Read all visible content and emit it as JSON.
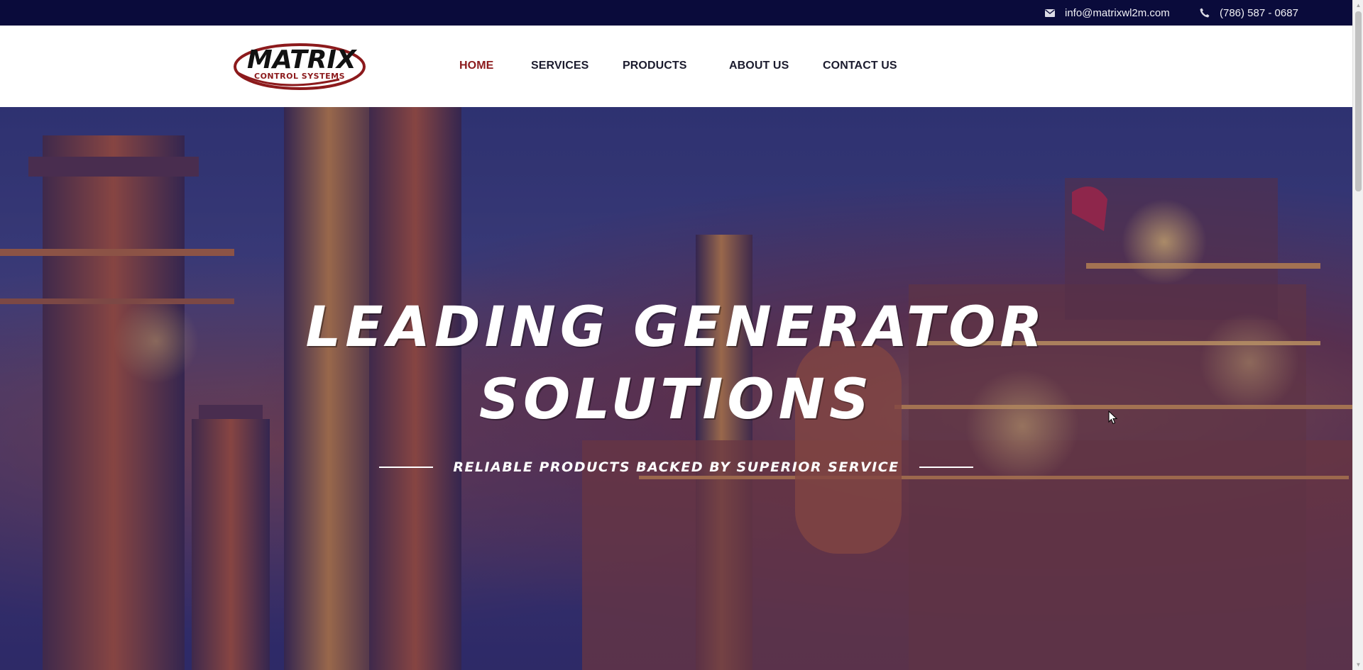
{
  "topbar": {
    "email": "info@matrixwl2m.com",
    "phone": "(786) 587 - 0687",
    "email_icon": "envelope-icon",
    "phone_icon": "phone-icon"
  },
  "brand": {
    "logo_word": "MATRIX",
    "logo_sub": "CONTROL SYSTEMS",
    "accent_color": "#8c1a1c",
    "dark_color": "#0a0b3b"
  },
  "nav": {
    "items": [
      {
        "label": "HOME",
        "active": true
      },
      {
        "label": "SERVICES",
        "active": false
      },
      {
        "label": "PRODUCTS",
        "active": false
      },
      {
        "label": "ABOUT US",
        "active": false
      },
      {
        "label": "CONTACT US",
        "active": false
      }
    ]
  },
  "hero": {
    "title_line1": "LEADING GENERATOR",
    "title_line2": "SOLUTIONS",
    "tagline": "RELIABLE PRODUCTS BACKED BY SUPERIOR SERVICE"
  }
}
